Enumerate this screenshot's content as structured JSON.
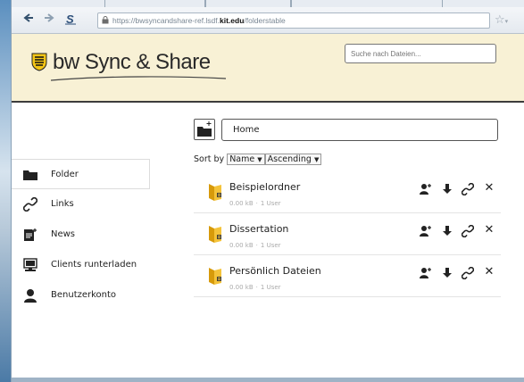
{
  "browser": {
    "url_prefix": "https://bwsyncandshare-ref.lsdf.",
    "url_domain": "kit.edu",
    "url_path": "/folderstable",
    "back_icon": "arrow-left-icon",
    "forward_icon": "arrow-right-icon",
    "site_icon": "s-icon",
    "star_icon": "star-icon"
  },
  "header": {
    "logo_text": "bw Sync & Share",
    "search_placeholder": "Suche nach Dateien..."
  },
  "sidebar": {
    "items": [
      {
        "label": "Folder",
        "icon": "folder-icon",
        "active": true
      },
      {
        "label": "Links",
        "icon": "link-icon",
        "active": false
      },
      {
        "label": "News",
        "icon": "news-icon",
        "active": false
      },
      {
        "label": "Clients runterladen",
        "icon": "clients-download-icon",
        "active": false
      },
      {
        "label": "Benutzerkonto",
        "icon": "user-icon",
        "active": false
      }
    ]
  },
  "main": {
    "breadcrumb": "Home",
    "sort": {
      "label": "Sort by",
      "field": "Name",
      "order": "Ascending"
    },
    "files": [
      {
        "name": "Beispielordner",
        "size": "0.00 kB",
        "users": "1 User"
      },
      {
        "name": "Dissertation",
        "size": "0.00 kB",
        "users": "1 User"
      },
      {
        "name": "Persönlich Dateien",
        "size": "0.00 kB",
        "users": "1 User"
      }
    ],
    "row_actions": {
      "share_icon": "share-user-icon",
      "download_icon": "download-icon",
      "link_icon": "link-icon",
      "delete_icon": "close-icon",
      "delete_glyph": "✕"
    }
  }
}
